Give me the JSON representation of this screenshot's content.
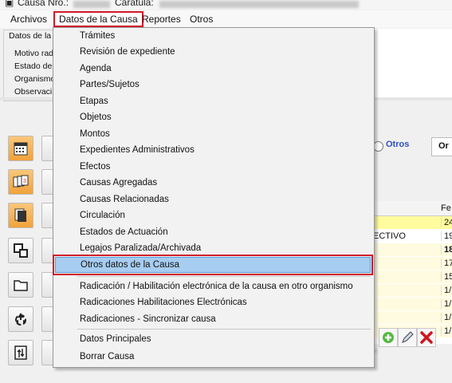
{
  "title_bar": {
    "causa_label": "Causa Nro.:",
    "caratula_label": "Caratula:"
  },
  "menubar": {
    "items": [
      {
        "label": "Archivos"
      },
      {
        "label": "Datos de la Causa"
      },
      {
        "label": "Reportes"
      },
      {
        "label": "Otros"
      }
    ]
  },
  "background": {
    "group_title": "Datos de la",
    "labels": [
      "Motivo rad",
      "Estado de",
      "Organismo",
      "Observaci"
    ],
    "radio_label": "Otros",
    "or_label": "Or",
    "grid_header": "Fe",
    "grid_rows": [
      {
        "c1": "",
        "c2": "24/"
      },
      {
        "c1": "ECTIVO",
        "c2": "19"
      },
      {
        "c1": "",
        "c2": "18."
      },
      {
        "c1": "",
        "c2": "17"
      },
      {
        "c1": "",
        "c2": "15"
      },
      {
        "c1": "",
        "c2": "1/"
      },
      {
        "c1": "",
        "c2": "1/"
      },
      {
        "c1": "",
        "c2": "1/"
      },
      {
        "c1": "",
        "c2": "1/"
      }
    ]
  },
  "dropdown": {
    "groups": [
      [
        "Trámites",
        "Revisión de expediente",
        "Agenda",
        "Partes/Sujetos",
        "Etapas",
        "Objetos",
        "Montos",
        "Expedientes Administrativos",
        "Efectos",
        "Causas Agregadas",
        "Causas Relacionadas",
        "Circulación",
        "Estados de Actuación",
        "Legajos Paralizada/Archivada",
        "Otros datos de la Causa"
      ],
      [
        "Radicación / Habilitación  electrónica de la causa en otro organismo",
        "Radicaciones Habilitaciones Electrónicas",
        "Radicaciones - Sincronizar causa"
      ],
      [
        "Datos Principales"
      ],
      [
        "Borrar Causa"
      ]
    ],
    "highlighted": "Otros datos de la Causa"
  },
  "colors": {
    "highlight_fill": "#a7cdf0",
    "annotation_red": "#d1182b",
    "grid_yellow": "#fffb9e"
  }
}
